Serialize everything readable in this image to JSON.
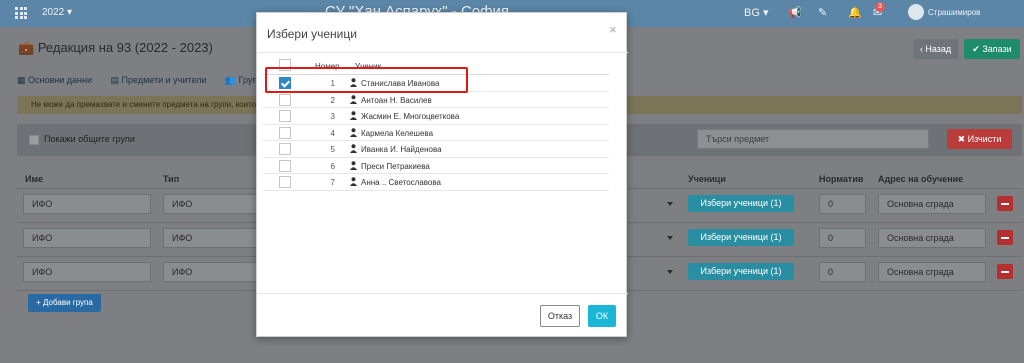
{
  "topbar": {
    "year": "2022 ▾",
    "school": "СУ \"Хан Аспарух\" - София",
    "lang": "BG ▾",
    "badge": "3",
    "user": "Страшимиров"
  },
  "page": {
    "title": "Редакция на 93 (2022 - 2023)",
    "back_label": "‹ Назад",
    "save_label": "✔ Запази",
    "tabs": [
      {
        "label": "Основни данни"
      },
      {
        "label": "Предмети и учители"
      },
      {
        "label": "Групи"
      }
    ],
    "warning": "Не може да премахвате и смените предмета на групи, които са",
    "show_common_groups": "Покажи общите групи",
    "search_placeholder": "Търси предмет",
    "clear_label": "✖ Изчисти",
    "columns": {
      "name": "Име",
      "type": "Тип",
      "students": "Ученици",
      "norm": "Норматив",
      "address": "Адрес на обучение"
    },
    "rows": [
      {
        "name": "ИФО",
        "type": "ИФО",
        "students_btn": "Избери ученици (1)",
        "norm": "0",
        "address": "Основна сграда"
      },
      {
        "name": "ИФО",
        "type": "ИФО",
        "students_btn": "Избери ученици (1)",
        "norm": "0",
        "address": "Основна сграда"
      },
      {
        "name": "ИФО",
        "type": "ИФО",
        "students_btn": "Избери ученици (1)",
        "norm": "0",
        "address": "Основна сграда"
      }
    ],
    "add_group": "+ Добави група"
  },
  "modal": {
    "title": "Избери ученици",
    "close": "×",
    "col_number": "Номер",
    "col_student": "Ученик",
    "students": [
      {
        "num": "1",
        "name": "Станислава Иванова",
        "checked": true
      },
      {
        "num": "2",
        "name": "Антоан Н. Василев",
        "checked": false
      },
      {
        "num": "3",
        "name": "Жасмин Е. Многоцветкова",
        "checked": false
      },
      {
        "num": "4",
        "name": "Кармела Келешева",
        "checked": false
      },
      {
        "num": "5",
        "name": "Иванка И. Найденова",
        "checked": false
      },
      {
        "num": "6",
        "name": "Преси Петракиева",
        "checked": false
      },
      {
        "num": "7",
        "name": "Анна .. Светославова",
        "checked": false
      }
    ],
    "cancel_label": "Отказ",
    "ok_label": "ОК"
  }
}
